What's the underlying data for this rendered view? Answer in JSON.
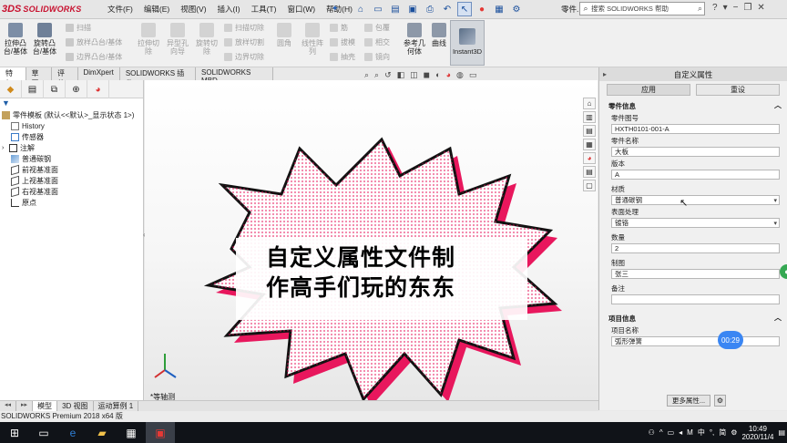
{
  "app": {
    "logo_mark": "3DS",
    "logo_text": "SOLIDWORKS"
  },
  "menu": [
    "文件(F)",
    "编辑(E)",
    "视图(V)",
    "插入(I)",
    "工具(T)",
    "窗口(W)",
    "帮助(H)"
  ],
  "toolbar": {
    "part_label": "零件...",
    "search_placeholder": "搜索 SOLIDWORKS 帮助"
  },
  "ribbon": {
    "extrude_boss": "拉伸凸\n台/基体",
    "revolve_boss": "旋转凸\n台/基体",
    "sweep": "扫描",
    "loft_boss": "放样凸台/基体",
    "boundary_boss": "边界凸台/基体",
    "extrude_cut": "拉伸切\n除",
    "hole_wizard": "异型孔\n向导",
    "revolve_cut": "旋转切\n除",
    "swept_cut": "扫描切除",
    "lofted_cut": "放样切割",
    "boundary_cut": "边界切除",
    "fillet": "圆角",
    "linear_pattern": "线性阵\n列",
    "rib": "筋",
    "draft": "拔模",
    "shell": "抽壳",
    "wrap": "包覆",
    "intersect": "相交",
    "mirror": "镜向",
    "ref_geometry": "参考几\n何体",
    "curves": "曲线",
    "instant3d": "Instant3D"
  },
  "command_tabs": [
    "特征",
    "草图",
    "评估",
    "DimXpert",
    "SOLIDWORKS 插件",
    "SOLIDWORKS MBD"
  ],
  "feature_tree": {
    "root": "零件模板 (默认<<默认>_显示状态 1>)",
    "items": [
      "History",
      "传感器",
      "注解",
      "普通碳钢",
      "前视基准面",
      "上视基准面",
      "右视基准面",
      "原点"
    ]
  },
  "viewport": {
    "view_name": "*等轴测",
    "overlay_caption_line1": "自定义属性文件制",
    "overlay_caption_line2": "作高手们玩的东东"
  },
  "custom_props": {
    "title": "自定义属性",
    "apply_button": "应用",
    "reset_button": "重设",
    "part_info_heading": "零件信息",
    "fields": [
      {
        "label": "零件图号",
        "value": "HXTH0101-001-A"
      },
      {
        "label": "零件名称",
        "value": "大板"
      },
      {
        "label": "版本",
        "value": "A"
      },
      {
        "label": "材质",
        "value": "普通碳钢"
      },
      {
        "label": "表面处理",
        "value": "镀铬"
      },
      {
        "label": "数量",
        "value": "2"
      },
      {
        "label": "制图",
        "value": "张三"
      },
      {
        "label": "备注",
        "value": ""
      }
    ],
    "project_heading": "项目信息",
    "project_fields": [
      {
        "label": "项目名称",
        "value": "弧形弹簧"
      }
    ],
    "more_button": "更多属性..."
  },
  "video": {
    "timer": "00:29"
  },
  "bottom_tabs": [
    "模型",
    "3D 视图",
    "运动算例 1"
  ],
  "status_text": "SOLIDWORKS Premium 2018 x64 版",
  "taskbar": {
    "ime_mid": "M",
    "ime_lang": "中",
    "ime_mode": "简",
    "time": "10:49",
    "date": "2020/11/4"
  },
  "colors": {
    "brand_red": "#c8102e",
    "accent_blue": "#3a86f3",
    "burst_pink": "#e8175d"
  }
}
